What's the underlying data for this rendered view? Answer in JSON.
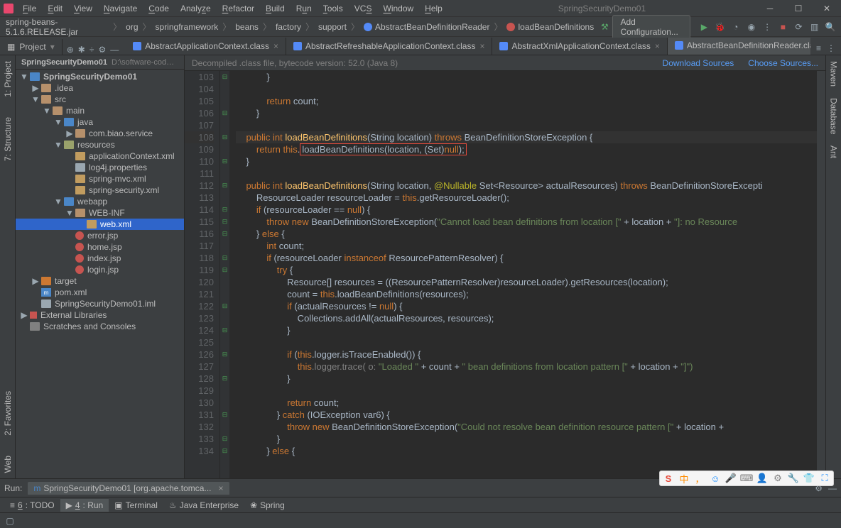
{
  "title_project": "SpringSecurityDemo01",
  "menu": [
    "File",
    "Edit",
    "View",
    "Navigate",
    "Code",
    "Analyze",
    "Refactor",
    "Build",
    "Run",
    "Tools",
    "VCS",
    "Window",
    "Help"
  ],
  "breadcrumbs": [
    "spring-beans-5.1.6.RELEASE.jar",
    "org",
    "springframework",
    "beans",
    "factory",
    "support",
    "AbstractBeanDefinitionReader",
    "loadBeanDefinitions"
  ],
  "add_config": "Add Configuration...",
  "project_label": "Project",
  "project_root_path": "D:\\software-code\\IDEAP...",
  "editor_tabs": [
    {
      "label": "AbstractApplicationContext.class",
      "active": false
    },
    {
      "label": "AbstractRefreshableApplicationContext.class",
      "active": false
    },
    {
      "label": "AbstractXmlApplicationContext.class",
      "active": false
    },
    {
      "label": "AbstractBeanDefinitionReader.class",
      "active": true
    }
  ],
  "decompiled_msg": "Decompiled .class file, bytecode version: 52.0 (Java 8)",
  "link_download": "Download Sources",
  "link_choose": "Choose Sources...",
  "tree": {
    "root": "SpringSecurityDemo01",
    "idea": ".idea",
    "src": "src",
    "main": "main",
    "java": "java",
    "pkg": "com.biao.service",
    "resources": "resources",
    "appctx": "applicationContext.xml",
    "log4j": "log4j.properties",
    "springmvc": "spring-mvc.xml",
    "springsec": "spring-security.xml",
    "webapp": "webapp",
    "webinf": "WEB-INF",
    "webxml": "web.xml",
    "errorjsp": "error.jsp",
    "homejsp": "home.jsp",
    "indexjsp": "index.jsp",
    "loginjsp": "login.jsp",
    "target": "target",
    "pom": "pom.xml",
    "iml": "SpringSecurityDemo01.iml",
    "extlib": "External Libraries",
    "scratch": "Scratches and Consoles"
  },
  "side_left": [
    "1: Project",
    "7: Structure",
    "2: Favorites",
    "Web"
  ],
  "side_right": [
    "Maven",
    "Database",
    "Ant"
  ],
  "lines_start": 103,
  "lines_end": 134,
  "code": {
    "l103": "            }",
    "l104": "",
    "l105_a": "            return ",
    "l105_b": "count;",
    "l106": "        }",
    "l107": "",
    "l108_a": "    public ",
    "l108_b": "int ",
    "l108_c": "loadBeanDefinitions",
    "l108_d": "(String location) ",
    "l108_e": "throws ",
    "l108_f": "BeanDefinitionStoreException {",
    "l109_a": "        return ",
    "l109_b": "this",
    "l109_c": ".",
    "l109_d": "loadBeanDefinitions(location, (Set)",
    "l109_e": "null",
    "l109_f": ");",
    "l110": "    }",
    "l111": "",
    "l112_a": "    public ",
    "l112_b": "int ",
    "l112_c": "loadBeanDefinitions",
    "l112_d": "(String location, ",
    "l112_e": "@Nullable ",
    "l112_f": "Set<Resource> actualResources) ",
    "l112_g": "throws ",
    "l112_h": "BeanDefinitionStoreExcepti",
    "l113_a": "        ResourceLoader resourceLoader = ",
    "l113_b": "this",
    "l113_c": ".getResourceLoader();",
    "l114_a": "        if ",
    "l114_b": "(resourceLoader == ",
    "l114_c": "null",
    "l114_d": ") {",
    "l115_a": "            throw new ",
    "l115_b": "BeanDefinitionStoreException(",
    "l115_c": "\"Cannot load bean definitions from location [\"",
    "l115_d": " + location + ",
    "l115_e": "\"]: no Resource",
    "l116_a": "        } ",
    "l116_b": "else ",
    "l116_c": "{",
    "l117_a": "            int ",
    "l117_b": "count;",
    "l118_a": "            if ",
    "l118_b": "(resourceLoader ",
    "l118_c": "instanceof ",
    "l118_d": "ResourcePatternResolver) {",
    "l119_a": "                try ",
    "l119_b": "{",
    "l120_a": "                    Resource[] resources = ((ResourcePatternResolver)resourceLoader).getResources(location);",
    "l121_a": "                    count = ",
    "l121_b": "this",
    "l121_c": ".loadBeanDefinitions(resources);",
    "l122_a": "                    if ",
    "l122_b": "(actualResources != ",
    "l122_c": "null",
    "l122_d": ") {",
    "l123_a": "                        Collections.addAll(actualResources, resources);",
    "l124": "                    }",
    "l125": "",
    "l126_a": "                    if ",
    "l126_b": "(",
    "l126_c": "this",
    "l126_d": ".logger.isTraceEnabled()) {",
    "l127_a": "                        ",
    "l127_b": "this",
    "l127_c": ".logger.trace( o: ",
    "l127_d": "\"Loaded \"",
    "l127_e": " + count + ",
    "l127_f": "\" bean definitions from location pattern [\"",
    "l127_g": " + location + ",
    "l127_h": "\"]\")",
    "l128": "                    }",
    "l129": "",
    "l130_a": "                    return ",
    "l130_b": "count;",
    "l131_a": "                } ",
    "l131_b": "catch ",
    "l131_c": "(IOException var6) {",
    "l132_a": "                    throw new ",
    "l132_b": "BeanDefinitionStoreException(",
    "l132_c": "\"Could not resolve bean definition resource pattern [\"",
    "l132_d": " + location +",
    "l133": "                }",
    "l134_a": "            } ",
    "l134_b": "else ",
    "l134_c": "{"
  },
  "run": {
    "label": "Run:",
    "tab": "SpringSecurityDemo01 [org.apache.tomca..."
  },
  "footer_btns": [
    "≡ 6: TODO",
    "▶ 4: Run",
    "▣ Terminal",
    "♨ Java Enterprise",
    "❀ Spring"
  ],
  "ime": [
    "S",
    "中",
    "，",
    "☺",
    "🎤",
    "⌨",
    "👤",
    "⚙",
    "🔧",
    "👕",
    "⛶"
  ]
}
